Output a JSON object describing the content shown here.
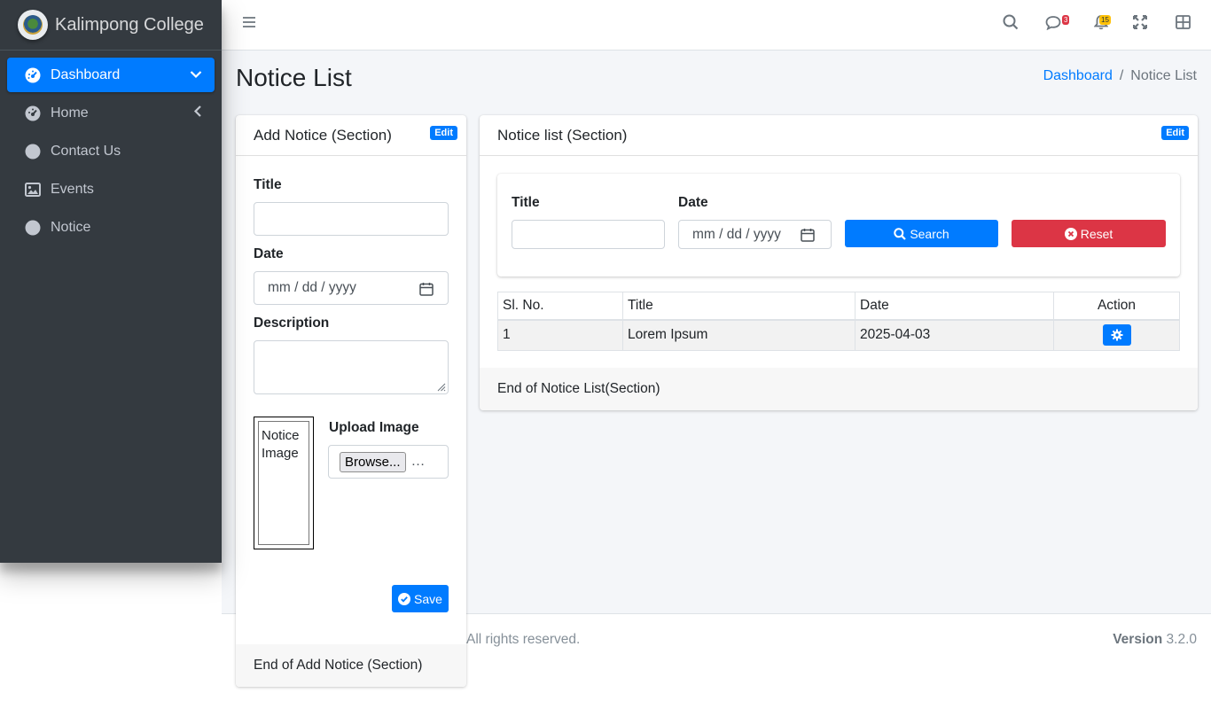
{
  "brand": {
    "name": "Kalimpong College"
  },
  "sidebar": {
    "items": [
      {
        "label": "Dashboard",
        "icon": "tachometer-icon",
        "active": true
      },
      {
        "label": "Home",
        "icon": "tachometer-icon"
      },
      {
        "label": "Contact Us",
        "icon": "circle-icon"
      },
      {
        "label": "Events",
        "icon": "image-icon"
      },
      {
        "label": "Notice",
        "icon": "circle-icon"
      }
    ]
  },
  "topbar": {
    "messages_count": "3",
    "notifications_count": "15"
  },
  "page": {
    "title": "Notice List"
  },
  "breadcrumb": {
    "home": "Dashboard",
    "current": "Notice List"
  },
  "add_card": {
    "header": "Add Notice (Section)",
    "edit_label": "Edit",
    "title_label": "Title",
    "date_label": "Date",
    "date_placeholder": "mm / dd / yyyy",
    "description_label": "Description",
    "image_alt": "Notice Image",
    "upload_label": "Upload Image",
    "browse_label": "Browse...",
    "browse_ellipsis": "…",
    "save_label": "Save",
    "footer": "End of Add Notice (Section)"
  },
  "list_card": {
    "header": "Notice list (Section)",
    "edit_label": "Edit",
    "title_label": "Title",
    "date_label": "Date",
    "date_placeholder": "mm / dd / yyyy",
    "search_label": "Search",
    "reset_label": "Reset",
    "columns": [
      "Sl. No.",
      "Title",
      "Date",
      "Action"
    ],
    "rows": [
      {
        "sl": "1",
        "title": "Lorem Ipsum",
        "date": "2025-04-03"
      }
    ],
    "footer": "End of Notice List(Section)"
  },
  "footer": {
    "rights": "All rights reserved.",
    "version_label": "Version",
    "version": "3.2.0"
  },
  "colors": {
    "primary": "#007bff",
    "danger": "#dc3545",
    "sidebar": "#343a40",
    "warning": "#ffc107"
  }
}
